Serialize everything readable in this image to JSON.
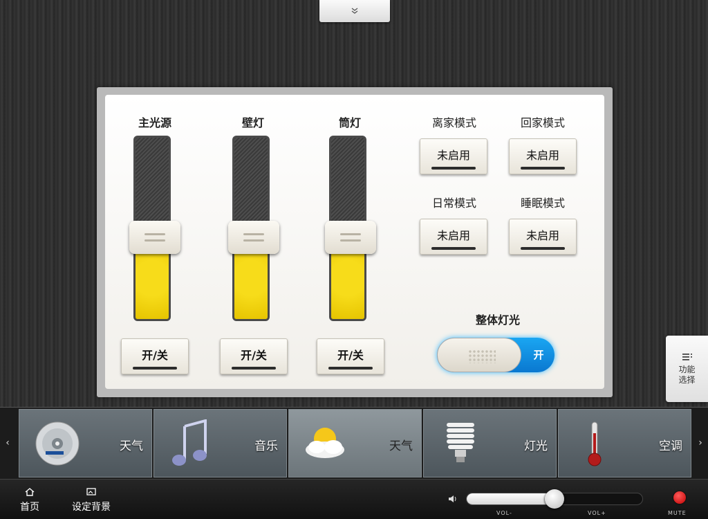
{
  "panel": {
    "sliders": [
      {
        "label": "主光源",
        "level": 0.45,
        "button": "开/关"
      },
      {
        "label": "壁灯",
        "level": 0.45,
        "button": "开/关"
      },
      {
        "label": "筒灯",
        "level": 0.45,
        "button": "开/关"
      }
    ],
    "modes": [
      {
        "label": "离家模式",
        "status": "未启用"
      },
      {
        "label": "回家模式",
        "status": "未启用"
      },
      {
        "label": "日常模式",
        "status": "未启用"
      },
      {
        "label": "睡眠模式",
        "status": "未启用"
      }
    ],
    "overall": {
      "label": "整体灯光",
      "state": "开"
    }
  },
  "side_tab": {
    "line1": "功能",
    "line2": "选择"
  },
  "dock": {
    "items": [
      {
        "label": "天气",
        "icon": "bluray-disc-icon"
      },
      {
        "label": "音乐",
        "icon": "music-note-icon"
      },
      {
        "label": "天气",
        "icon": "weather-icon",
        "active": true
      },
      {
        "label": "灯光",
        "icon": "bulb-icon"
      },
      {
        "label": "空调",
        "icon": "thermometer-icon"
      }
    ]
  },
  "bottom": {
    "home": "首页",
    "background": "设定背景",
    "vol_minus": "VOL-",
    "vol_plus": "VOL+",
    "mute": "MUTE",
    "volume_level": 0.5
  },
  "colors": {
    "accent": "#1596e6",
    "fill": "#f2d30a"
  }
}
